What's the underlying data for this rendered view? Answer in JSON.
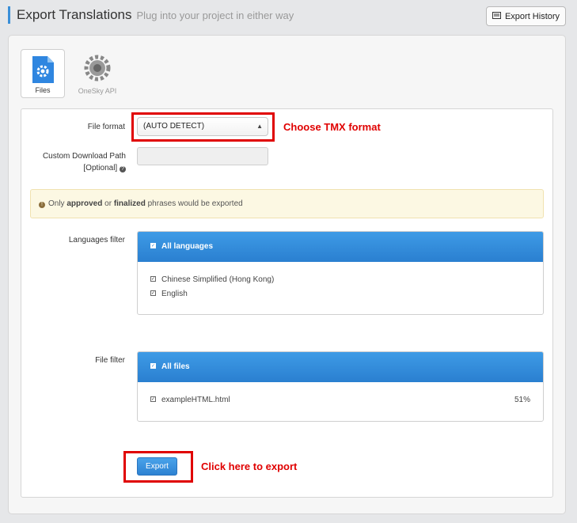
{
  "header": {
    "title": "Export Translations",
    "subtitle": "Plug into your project in either way",
    "history_button": "Export History"
  },
  "tabs": [
    {
      "label": "Files",
      "icon": "file-gear-icon",
      "active": true
    },
    {
      "label": "OneSky API",
      "icon": "gear-icon",
      "active": false
    }
  ],
  "form": {
    "file_format_label": "File format",
    "file_format_value": "(AUTO DETECT)",
    "custom_path_label_1": "Custom Download Path",
    "custom_path_label_2": "[Optional]",
    "custom_path_value": "",
    "alert": {
      "prefix": "Only",
      "approved": "approved",
      "or": "or",
      "finalized": "finalized",
      "suffix": "phrases would be exported"
    },
    "languages_filter_label": "Languages filter",
    "languages_all": "All languages",
    "languages": [
      "Chinese Simplified (Hong Kong)",
      "English"
    ],
    "file_filter_label": "File filter",
    "files_all": "All files",
    "files": [
      {
        "name": "exampleHTML.html",
        "percent": "51%"
      }
    ],
    "export_button": "Export"
  },
  "annotations": {
    "format_note": "Choose TMX format",
    "export_note": "Click here to export"
  },
  "colors": {
    "accent": "#3a8fd8",
    "annotation_red": "#e00000",
    "alert_bg": "#fcf8e3"
  }
}
